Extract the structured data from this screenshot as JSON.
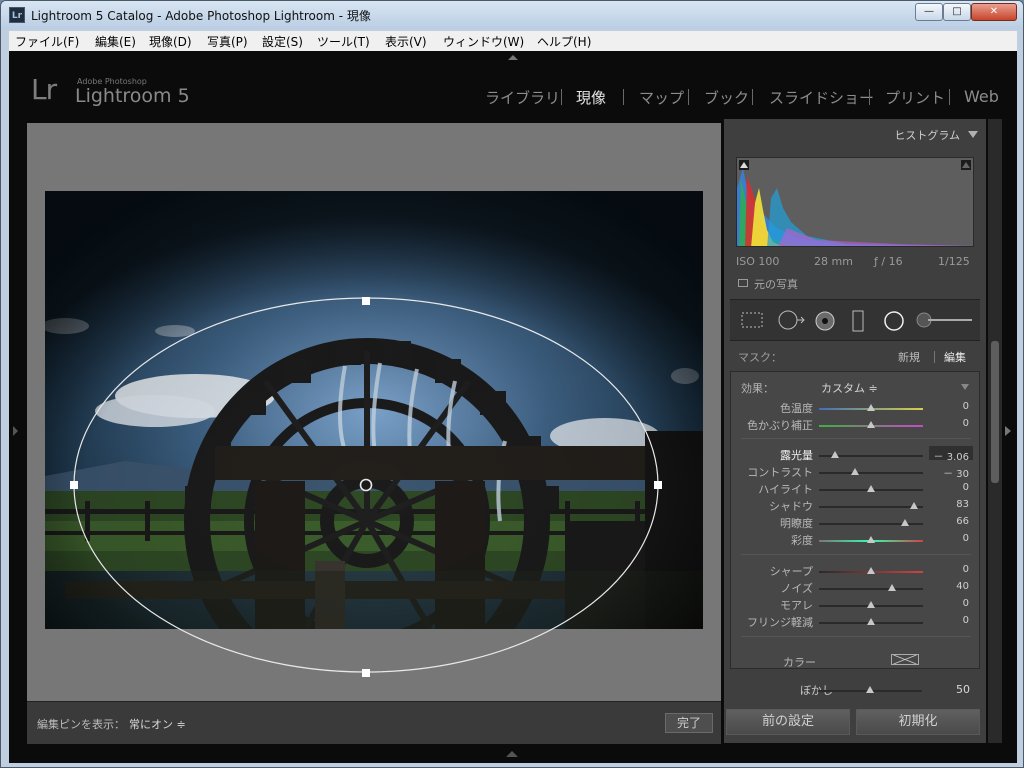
{
  "window": {
    "title": "Lightroom 5 Catalog - Adobe Photoshop Lightroom - 現像",
    "app_icon": "Lr",
    "min_glyph": "—",
    "max_glyph": "□",
    "close_glyph": "✕"
  },
  "menu": [
    "ファイル(F)",
    "編集(E)",
    "現像(D)",
    "写真(P)",
    "設定(S)",
    "ツール(T)",
    "表示(V)",
    "ウィンドウ(W)",
    "ヘルプ(H)"
  ],
  "logo": {
    "mark": "Lr",
    "line1": "Adobe Photoshop",
    "line2": "Lightroom 5"
  },
  "modules": [
    {
      "label": "ライブラリ",
      "active": false
    },
    {
      "label": "現像",
      "active": true
    },
    {
      "label": "マップ",
      "active": false
    },
    {
      "label": "ブック",
      "active": false
    },
    {
      "label": "スライドショー",
      "active": false
    },
    {
      "label": "プリント",
      "active": false
    },
    {
      "label": "Web",
      "active": false
    }
  ],
  "toolbar": {
    "pin_label": "編集ピンを表示：",
    "pin_value": "常にオン ≑",
    "done_label": "完了"
  },
  "histogram": {
    "title": "ヒストグラム",
    "iso": "ISO 100",
    "focal": "28 mm",
    "aperture": "ƒ / 16",
    "shutter": "1/125",
    "original_label": "元の写真"
  },
  "mask": {
    "label": "マスク：",
    "new_label": "新規",
    "edit_label": "編集"
  },
  "effect": {
    "label": "効果：",
    "value": "カスタム ≑"
  },
  "sliders": {
    "temp": {
      "label": "色温度",
      "value": "0",
      "pos": 0.5
    },
    "tint": {
      "label": "色かぶり補正",
      "value": "0",
      "pos": 0.5
    },
    "exposure": {
      "label": "露光量",
      "value": "－ 3.06",
      "pos": 0.15
    },
    "contrast": {
      "label": "コントラスト",
      "value": "－ 30",
      "pos": 0.35
    },
    "highlights": {
      "label": "ハイライト",
      "value": "0",
      "pos": 0.5
    },
    "shadows": {
      "label": "シャドウ",
      "value": "83",
      "pos": 0.915
    },
    "clarity": {
      "label": "明瞭度",
      "value": "66",
      "pos": 0.83
    },
    "saturation": {
      "label": "彩度",
      "value": "0",
      "pos": 0.5
    },
    "sharpness": {
      "label": "シャープ",
      "value": "0",
      "pos": 0.5
    },
    "noise": {
      "label": "ノイズ",
      "value": "40",
      "pos": 0.7
    },
    "moire": {
      "label": "モアレ",
      "value": "0",
      "pos": 0.5
    },
    "defringe": {
      "label": "フリンジ軽減",
      "value": "0",
      "pos": 0.5
    }
  },
  "color_label": "カラー",
  "feather": {
    "label": "ぼかし",
    "value": "50",
    "pos": 0.5
  },
  "buttons": {
    "previous": "前の設定",
    "reset": "初期化"
  },
  "colors": {
    "panel": "#3f3f3f",
    "active_text": "#e6e6e6",
    "bg_dark": "#0b0b0b"
  }
}
